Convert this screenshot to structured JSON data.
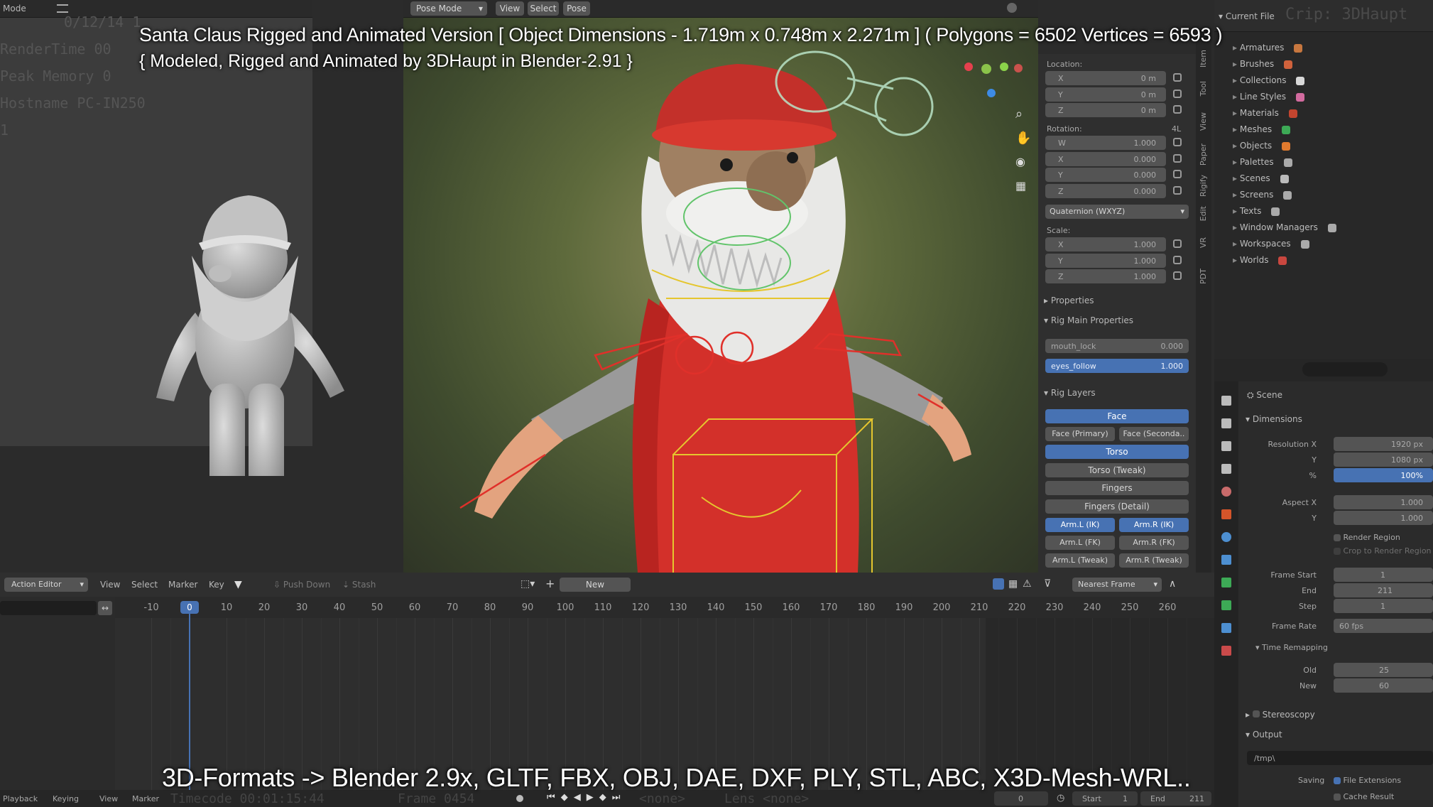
{
  "overlay": {
    "title_line1": "Santa Claus Rigged and Animated Version [ Object Dimensions -  1.719m x 0.748m x 2.271m ] ( Polygons = 6502  Vertices = 6593 )",
    "title_line2": "{ Modeled, Rigged and Animated by 3DHaupt in Blender-2.91 }",
    "formats_line": "3D-Formats -> Blender 2.9x, GLTF, FBX, OBJ, DAE, DXF, PLY, STL, ABC, X3D-Mesh-WRL.."
  },
  "left_viewport": {
    "mode": "Mode",
    "stats": [
      "RenderTime 00",
      "Peak Memory 0",
      "Hostname PC-IN250",
      "1"
    ],
    "timestamp": "0/12/14 1"
  },
  "main_header": {
    "mode": "Pose Mode",
    "menus": [
      "View",
      "Select",
      "Pose"
    ]
  },
  "transform": {
    "location_label": "Location:",
    "location": [
      {
        "axis": "X",
        "value": "0 m"
      },
      {
        "axis": "Y",
        "value": "0 m"
      },
      {
        "axis": "Z",
        "value": "0 m"
      }
    ],
    "rotation_label": "Rotation:",
    "rotation_mode_short": "4L",
    "rotation": [
      {
        "axis": "W",
        "value": "1.000"
      },
      {
        "axis": "X",
        "value": "0.000"
      },
      {
        "axis": "Y",
        "value": "0.000"
      },
      {
        "axis": "Z",
        "value": "0.000"
      }
    ],
    "rotation_mode": "Quaternion (WXYZ)",
    "scale_label": "Scale:",
    "scale": [
      {
        "axis": "X",
        "value": "1.000"
      },
      {
        "axis": "Y",
        "value": "1.000"
      },
      {
        "axis": "Z",
        "value": "1.000"
      }
    ],
    "properties_label": "Properties",
    "rig_main_label": "Rig Main Properties",
    "mouth_lock": {
      "label": "mouth_lock",
      "value": "0.000"
    },
    "eyes_follow": {
      "label": "eyes_follow",
      "value": "1.000"
    },
    "rig_layers_label": "Rig Layers",
    "layers": {
      "face": "Face",
      "face_primary": "Face (Primary)",
      "face_secondary": "Face (Seconda..",
      "torso": "Torso",
      "torso_tweak": "Torso (Tweak)",
      "fingers": "Fingers",
      "fingers_detail": "Fingers (Detail)",
      "arm_l_ik": "Arm.L (IK)",
      "arm_r_ik": "Arm.R (IK)",
      "arm_l_fk": "Arm.L (FK)",
      "arm_r_fk": "Arm.R (FK)",
      "arm_l_tweak": "Arm.L (Tweak)",
      "arm_r_tweak": "Arm.R (Tweak)"
    }
  },
  "side_tabs": [
    "Item",
    "Tool",
    "View",
    "Paper",
    "Rigify",
    "Edit",
    "VR",
    "PDT"
  ],
  "outliner": {
    "root": "Current File",
    "overlay_text": "Crip: 3DHaupt",
    "items": [
      "Armatures",
      "Brushes",
      "Collections",
      "Line Styles",
      "Materials",
      "Meshes",
      "Objects",
      "Palettes",
      "Scenes",
      "Screens",
      "Texts",
      "Window Managers",
      "Workspaces",
      "Worlds"
    ]
  },
  "properties": {
    "scene_label": "Scene",
    "dimensions_label": "Dimensions",
    "resolution_x_label": "Resolution X",
    "resolution_x": "1920 px",
    "y_label": "Y",
    "resolution_y": "1080 px",
    "percent_label": "%",
    "percent": "100%",
    "aspect_x_label": "Aspect X",
    "aspect_x": "1.000",
    "aspect_y": "1.000",
    "render_region": "Render Region",
    "crop_region": "Crop to Render Region",
    "frame_start_label": "Frame Start",
    "frame_start": "1",
    "end_label": "End",
    "frame_end": "211",
    "step_label": "Step",
    "frame_step": "1",
    "frame_rate_label": "Frame Rate",
    "frame_rate": "60 fps",
    "time_remap_label": "Time Remapping",
    "old_label": "Old",
    "old_value": "25",
    "new_label": "New",
    "new_value": "60",
    "stereoscopy_label": "Stereoscopy",
    "output_label": "Output",
    "output_path": "/tmp\\",
    "saving_label": "Saving",
    "file_extensions": "File Extensions",
    "cache_result": "Cache Result"
  },
  "action_editor": {
    "mode": "Action Editor",
    "menus": [
      "View",
      "Select",
      "Marker",
      "Key"
    ],
    "push_down": "Push Down",
    "stash": "Stash",
    "new_btn": "New",
    "snap": "Nearest Frame",
    "current_frame": "0",
    "ticks": [
      "-10",
      "0",
      "10",
      "20",
      "30",
      "40",
      "50",
      "60",
      "70",
      "80",
      "90",
      "100",
      "110",
      "120",
      "130",
      "140",
      "150",
      "160",
      "170",
      "180",
      "190",
      "200",
      "210",
      "220",
      "230",
      "240",
      "250",
      "260"
    ]
  },
  "bottom_bar": {
    "playback": "Playback",
    "keying": "Keying",
    "view": "View",
    "marker": "Marker",
    "timecode": "Timecode 00:01:15:44",
    "frame": "Frame 0454",
    "none1": "<none>",
    "lens": "Lens <none>",
    "current": "0",
    "start_label": "Start",
    "start": "1",
    "end_label": "End",
    "end": "211"
  },
  "colors": {
    "accent": "#4772b3",
    "rig_red": "#e0302a",
    "rig_yellow": "#e5c62e"
  }
}
